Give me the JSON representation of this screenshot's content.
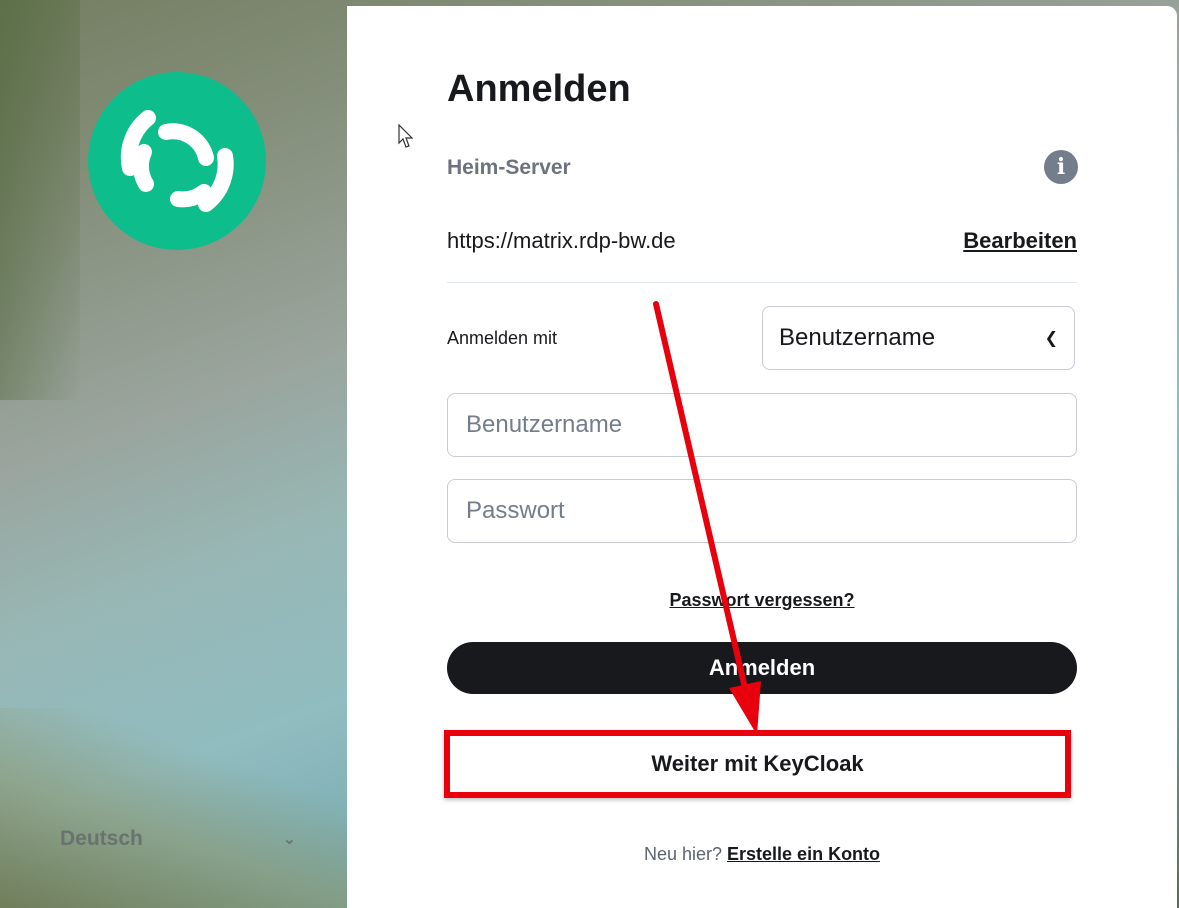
{
  "sidebar": {
    "language": "Deutsch"
  },
  "login": {
    "title": "Anmelden",
    "homeserver_label": "Heim-Server",
    "homeserver_url": "https://matrix.rdp-bw.de",
    "edit_label": "Bearbeiten",
    "login_with_label": "Anmelden mit",
    "login_with_value": "Benutzername",
    "username_placeholder": "Benutzername",
    "password_placeholder": "Passwort",
    "forgot_password": "Passwort vergessen?",
    "submit_label": "Anmelden",
    "sso_label": "Weiter mit KeyCloak",
    "new_here": "Neu hier?",
    "create_account": "Erstelle ein Konto"
  },
  "colors": {
    "brand": "#0dbd8b",
    "button": "#17191c",
    "annotation": "#e8000c"
  }
}
